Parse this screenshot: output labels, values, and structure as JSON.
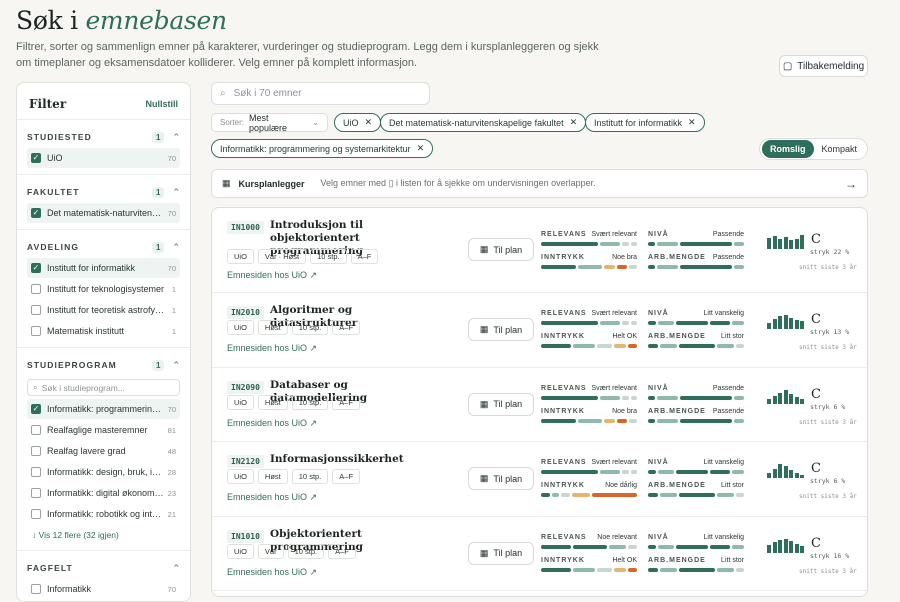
{
  "page": {
    "title_main": "Søk i",
    "title_em": "emnebasen",
    "intro": "Filtrer, sorter og sammenlign emner på karakterer, vurderinger og studieprogram. Legg dem i kursplanleggeren og sjekk om timeplaner og eksamensdatoer kolliderer. Velg emner på komplett informasjon.",
    "feedback": "Tilbakemelding"
  },
  "sidebar": {
    "title": "Filter",
    "reset": "Nullstill",
    "sections": [
      {
        "title": "STUDIESTED",
        "count": "1",
        "options": [
          {
            "label": "UiO",
            "n": "70",
            "sel": true
          }
        ]
      },
      {
        "title": "FAKULTET",
        "count": "1",
        "options": [
          {
            "label": "Det matematisk-naturvitenskapelige fakultet",
            "n": "70",
            "sel": true
          }
        ]
      },
      {
        "title": "AVDELING",
        "count": "1",
        "options": [
          {
            "label": "Institutt for informatikk",
            "n": "70",
            "sel": true
          },
          {
            "label": "Institutt for teknologisystemer",
            "n": "1",
            "sel": false
          },
          {
            "label": "Institutt for teoretisk astrofysikk",
            "n": "1",
            "sel": false
          },
          {
            "label": "Matematisk institutt",
            "n": "1",
            "sel": false
          }
        ]
      },
      {
        "title": "STUDIEPROGRAM",
        "count": "1",
        "search": "Søk i studieprogram...",
        "more": "Vis 12 flere (32 igjen)",
        "options": [
          {
            "label": "Informatikk: programmering og systemarkitektur",
            "n": "70",
            "sel": true
          },
          {
            "label": "Realfaglige masteremner",
            "n": "81",
            "sel": false
          },
          {
            "label": "Realfag lavere grad",
            "n": "48",
            "sel": false
          },
          {
            "label": "Informatikk: design, bruk, interaksjon",
            "n": "28",
            "sel": false
          },
          {
            "label": "Informatikk: digital økonomi og ledelse",
            "n": "23",
            "sel": false
          },
          {
            "label": "Informatikk: robotikk og intelligente systemer",
            "n": "21",
            "sel": false
          }
        ]
      },
      {
        "title": "FAGFELT",
        "count": "",
        "options": [
          {
            "label": "Informatikk",
            "n": "70",
            "sel": false
          }
        ]
      }
    ]
  },
  "search": {
    "placeholder": "Søk i 70 emner"
  },
  "sort": {
    "label": "Sorter:",
    "value": "Mest populære"
  },
  "chips": [
    "UiO",
    "Det matematisk-naturvitenskapelige fakultet",
    "Institutt for informatikk",
    "Informatikk: programmering og systemarkitektur"
  ],
  "view": {
    "comfy": "Romslig",
    "compact": "Kompakt"
  },
  "planner": {
    "label": "Kursplanlegger",
    "desc": "Velg emner med ▯ i listen for å sjekke om undervisningen overlapper."
  },
  "labels": {
    "relevans": "RELEVANS",
    "inntrykk": "INNTRYKK",
    "niva": "NIVÅ",
    "arb": "ARB.MENGDE",
    "plan": "Til plan",
    "link": "Emnesiden hos UiO",
    "avg": "snitt siste 3 år"
  },
  "colors": {
    "accent": "#2f6e5c",
    "light": "#8fb9a9",
    "orange": "#d9652b",
    "amber": "#e5b56a"
  },
  "courses": [
    {
      "code": "IN1000",
      "name": "Introduksjon til objektorientert programmering",
      "tags": [
        "UiO",
        "Vår · Høst",
        "10 stp.",
        "A–F"
      ],
      "relevans": "Svært relevant",
      "inntrykk": "Noe bra",
      "niva": "Passende",
      "arb": "Passende",
      "grade": "C",
      "stryk": "stryk 22 %",
      "spark": [
        10,
        12,
        9,
        11,
        8,
        9,
        13
      ]
    },
    {
      "code": "IN2010",
      "name": "Algoritmer og datastrukturer",
      "tags": [
        "UiO",
        "Høst",
        "10 stp.",
        "A–F"
      ],
      "relevans": "Svært relevant",
      "inntrykk": "Helt OK",
      "niva": "Litt vanskelig",
      "arb": "Litt stor",
      "grade": "C",
      "stryk": "stryk 13 %",
      "spark": [
        6,
        9,
        12,
        13,
        10,
        8,
        7
      ]
    },
    {
      "code": "IN2090",
      "name": "Databaser og datamodellering",
      "tags": [
        "UiO",
        "Høst",
        "10 stp.",
        "A–F"
      ],
      "relevans": "Svært relevant",
      "inntrykk": "Noe bra",
      "niva": "Passende",
      "arb": "Passende",
      "grade": "C",
      "stryk": "stryk 6 %",
      "spark": [
        4,
        7,
        10,
        13,
        9,
        6,
        4
      ]
    },
    {
      "code": "IN2120",
      "name": "Informasjonssikkerhet",
      "tags": [
        "UiO",
        "Høst",
        "10 stp.",
        "A–F"
      ],
      "relevans": "Svært relevant",
      "inntrykk": "Noe dårlig",
      "niva": "Litt vanskelig",
      "arb": "Litt stor",
      "grade": "C",
      "stryk": "stryk 6 %",
      "spark": [
        5,
        8,
        13,
        11,
        7,
        5,
        3
      ]
    },
    {
      "code": "IN1010",
      "name": "Objektorientert programmering",
      "tags": [
        "UiO",
        "Vår",
        "10 stp.",
        "A–F"
      ],
      "relevans": "Noe relevant",
      "inntrykk": "Helt OK",
      "niva": "Litt vanskelig",
      "arb": "Litt stor",
      "grade": "C",
      "stryk": "stryk 16 %",
      "spark": [
        7,
        10,
        12,
        13,
        11,
        8,
        6
      ]
    }
  ]
}
